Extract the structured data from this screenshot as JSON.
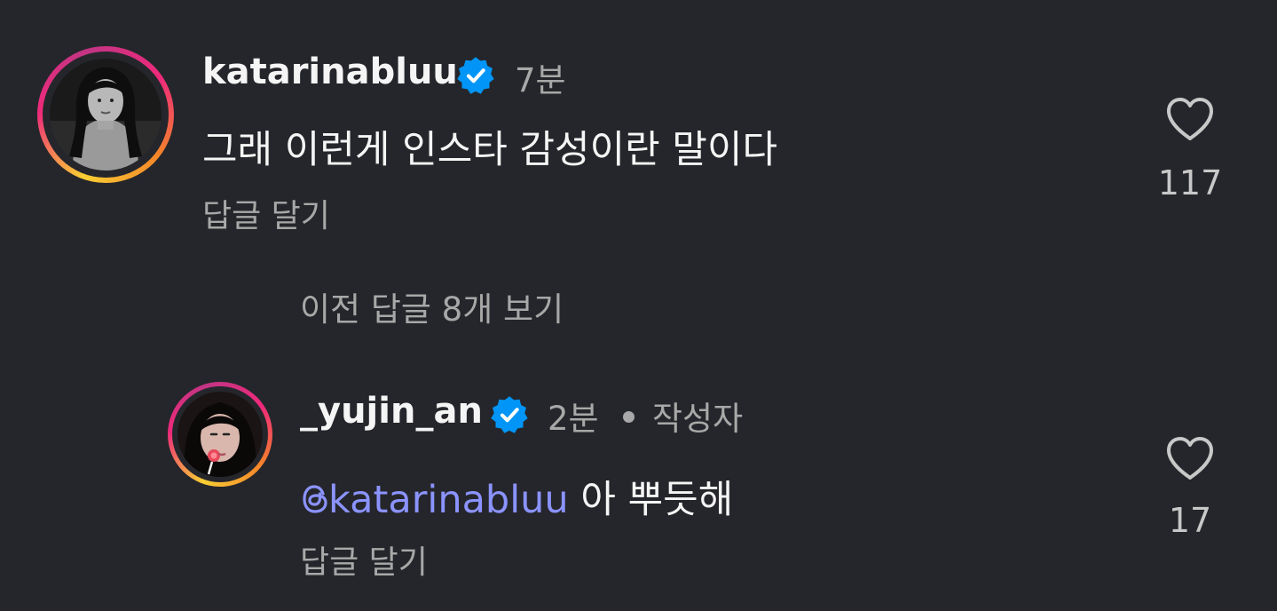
{
  "comments": [
    {
      "username": "katarinabluu",
      "time": "7분",
      "text": "그래 이런게 인스타 감성이란 말이다",
      "reply_label": "답글 달기",
      "likes": "117"
    }
  ],
  "view_previous_replies": "이전 답글 8개 보기",
  "replies": [
    {
      "username": "_yujin_an",
      "time": "2분",
      "author_badge": "작성자",
      "mention": "@katarinabluu",
      "text": " 아 뿌듯해",
      "reply_label": "답글 달기",
      "likes": "17"
    }
  ],
  "colors": {
    "background": "#25262b",
    "verified": "#0095f6",
    "mention": "#8b93ff"
  },
  "icons": {
    "verified": "verified-badge-icon",
    "like": "heart-outline-icon",
    "threads": "threads-icon"
  }
}
